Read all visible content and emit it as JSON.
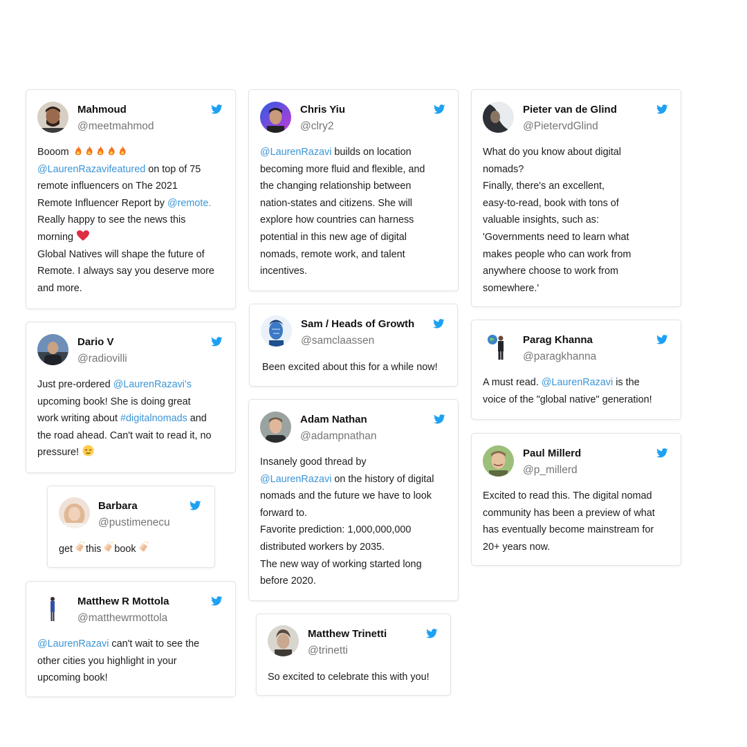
{
  "colors": {
    "twitter_blue": "#1da1f2",
    "mention": "#3b95d6",
    "handle": "#757575",
    "card_border": "#e3e3e3"
  },
  "tweets": [
    {
      "name": "Mahmoud",
      "handle": "@meetmahmod",
      "icon": "twitter-bird-icon",
      "lines": [
        {
          "parts": [
            {
              "t": "Booom "
            }
          ]
        },
        {
          "parts": [
            {
              "t": " @LaurenRazavifeatured",
              "m": true
            },
            {
              "t": " on top of 75"
            }
          ]
        },
        {
          "parts": [
            {
              "t": "remote influencers on The 2021"
            }
          ]
        },
        {
          "parts": [
            {
              "t": "Remote Influencer Report by "
            },
            {
              "t": "@remote.",
              "m": true
            }
          ]
        },
        {
          "parts": [
            {
              "t": "Really happy to see the news this"
            }
          ]
        },
        {
          "parts": [
            {
              "t": "morning "
            }
          ]
        },
        {
          "parts": [
            {
              "t": "Global Natives will shape the future of"
            }
          ]
        },
        {
          "parts": [
            {
              "t": "Remote. I always say you deserve more"
            }
          ]
        },
        {
          "parts": [
            {
              "t": "and more."
            }
          ]
        }
      ]
    },
    {
      "name": "Dario V",
      "handle": "@radiovilli",
      "icon": "twitter-bird-icon",
      "lines": [
        {
          "parts": [
            {
              "t": "Just pre-ordered "
            },
            {
              "t": "@LaurenRazavi's",
              "m": true
            }
          ]
        },
        {
          "parts": [
            {
              "t": "upcoming book! She is doing great"
            }
          ]
        },
        {
          "parts": [
            {
              "t": "work writing about "
            },
            {
              "t": "#digitalnomads",
              "m": true
            },
            {
              "t": " and"
            }
          ]
        },
        {
          "parts": [
            {
              "t": "the road ahead. Can't wait to read it, no"
            }
          ]
        },
        {
          "parts": [
            {
              "t": "pressure! "
            }
          ]
        }
      ]
    },
    {
      "name": "Barbara",
      "handle": "@pustimenecu",
      "icon": "twitter-bird-icon",
      "lines": [
        {
          "parts": [
            {
              "t": "get"
            },
            {
              "t": "this"
            },
            {
              "t": "book"
            }
          ]
        }
      ]
    },
    {
      "name": "Matthew R Mottola",
      "handle": "@matthewrmottola",
      "icon": "twitter-bird-icon",
      "lines": [
        {
          "parts": [
            {
              "t": "@LaurenRazavi",
              "m": true
            },
            {
              "t": " can't wait to see the"
            }
          ]
        },
        {
          "parts": [
            {
              "t": "other cities you highlight in your"
            }
          ]
        },
        {
          "parts": [
            {
              "t": "upcoming book!"
            }
          ]
        }
      ]
    },
    {
      "name": "Chris Yiu",
      "handle": "@clry2",
      "icon": "twitter-bird-icon",
      "lines": [
        {
          "parts": [
            {
              "t": "@LaurenRazavi",
              "m": true
            },
            {
              "t": " builds on location"
            }
          ]
        },
        {
          "parts": [
            {
              "t": "becoming more fluid and flexible, and"
            }
          ]
        },
        {
          "parts": [
            {
              "t": "the changing relationship between"
            }
          ]
        },
        {
          "parts": [
            {
              "t": "nation-states and citizens. She will"
            }
          ]
        },
        {
          "parts": [
            {
              "t": "explore how countries can harness"
            }
          ]
        },
        {
          "parts": [
            {
              "t": "potential in this new age of digital"
            }
          ]
        },
        {
          "parts": [
            {
              "t": "nomads, remote work, and talent"
            }
          ]
        },
        {
          "parts": [
            {
              "t": "incentives."
            }
          ]
        }
      ]
    },
    {
      "name": "Sam / Heads of Growth",
      "handle": "@samclaassen",
      "icon": "twitter-bird-icon",
      "lines": [
        {
          "parts": [
            {
              "t": "Been excited about this for a while now!"
            }
          ]
        }
      ]
    },
    {
      "name": "Adam Nathan",
      "handle": "@adampnathan",
      "icon": "twitter-bird-icon",
      "lines": [
        {
          "parts": [
            {
              "t": "Insanely good thread by"
            }
          ]
        },
        {
          "parts": [
            {
              "t": "@LaurenRazavi",
              "m": true
            },
            {
              "t": " on the history of digital"
            }
          ]
        },
        {
          "parts": [
            {
              "t": "nomads and the future we have to look"
            }
          ]
        },
        {
          "parts": [
            {
              "t": "forward to."
            }
          ]
        },
        {
          "parts": [
            {
              "t": "Favorite prediction: 1,000,000,000"
            }
          ]
        },
        {
          "parts": [
            {
              "t": "distributed workers by 2035."
            }
          ]
        },
        {
          "parts": [
            {
              "t": "The new way of working started long"
            }
          ]
        },
        {
          "parts": [
            {
              "t": "before 2020."
            }
          ]
        }
      ]
    },
    {
      "name": "Matthew Trinetti",
      "handle": "@trinetti",
      "icon": "twitter-bird-icon",
      "lines": [
        {
          "parts": [
            {
              "t": "So excited to celebrate this with you!"
            }
          ]
        }
      ]
    },
    {
      "name": "Pieter van de Glind",
      "handle": "@PietervdGlind",
      "icon": "twitter-bird-icon",
      "lines": [
        {
          "parts": [
            {
              "t": "What do you know about digital"
            }
          ]
        },
        {
          "parts": [
            {
              "t": "nomads?"
            }
          ]
        },
        {
          "parts": [
            {
              "t": "Finally, there's an excellent,"
            }
          ]
        },
        {
          "parts": [
            {
              "t": "easy-to-read, book with tons of"
            }
          ]
        },
        {
          "parts": [
            {
              "t": "valuable insights, such as:"
            }
          ]
        },
        {
          "parts": [
            {
              "t": " 'Governments need to learn what"
            }
          ]
        },
        {
          "parts": [
            {
              "t": "makes people who can work from"
            }
          ]
        },
        {
          "parts": [
            {
              "t": "anywhere choose to work from"
            }
          ]
        },
        {
          "parts": [
            {
              "t": "somewhere.'"
            }
          ]
        }
      ]
    },
    {
      "name": "Parag Khanna",
      "handle": "@paragkhanna",
      "icon": "twitter-bird-icon",
      "lines": [
        {
          "parts": [
            {
              "t": "A must read. "
            },
            {
              "t": "@LaurenRazavi",
              "m": true
            },
            {
              "t": " is the"
            }
          ]
        },
        {
          "parts": [
            {
              "t": "voice of the \"global native\" generation!"
            }
          ]
        }
      ]
    },
    {
      "name": "Paul Millerd",
      "handle": "@p_millerd",
      "icon": "twitter-bird-icon",
      "lines": [
        {
          "parts": [
            {
              "t": "Excited to read this.  The digital nomad"
            }
          ]
        },
        {
          "parts": [
            {
              "t": "community has been a preview of what"
            }
          ]
        },
        {
          "parts": [
            {
              "t": "has eventually become mainstream for"
            }
          ]
        },
        {
          "parts": [
            {
              "t": "20+ years now."
            }
          ]
        }
      ]
    }
  ]
}
